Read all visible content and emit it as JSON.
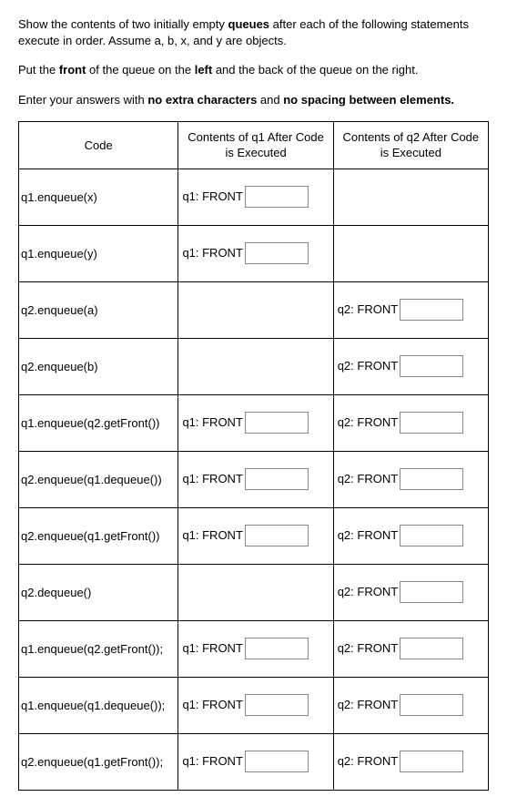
{
  "instructions": {
    "p1_a": "Show the contents of two initially empty ",
    "p1_b": "queues",
    "p1_c": " after each of the following statements execute in order. Assume a, b, x, and y are objects.",
    "p2_a": "Put the ",
    "p2_b": "front",
    "p2_c": " of the queue on the ",
    "p2_d": "left",
    "p2_e": " and the back of the queue on the right.",
    "p3_a": "Enter your answers with ",
    "p3_b": "no extra characters",
    "p3_c": " and ",
    "p3_d": "no spacing between elements."
  },
  "headers": {
    "code": "Code",
    "q1": "Contents of q1 After Code is Executed",
    "q2": "Contents of q2 After Code is Executed"
  },
  "labels": {
    "q1front": "q1: FRONT",
    "q2front": "q2: FRONT"
  },
  "rows": [
    {
      "code": "q1.enqueue(x)",
      "q1": true,
      "q2": false
    },
    {
      "code": "q1.enqueue(y)",
      "q1": true,
      "q2": false
    },
    {
      "code": "q2.enqueue(a)",
      "q1": false,
      "q2": true
    },
    {
      "code": "q2.enqueue(b)",
      "q1": false,
      "q2": true
    },
    {
      "code": "q1.enqueue(q2.getFront())",
      "q1": true,
      "q2": true
    },
    {
      "code": "q2.enqueue(q1.dequeue())",
      "q1": true,
      "q2": true
    },
    {
      "code": "q2.enqueue(q1.getFront())",
      "q1": true,
      "q2": true
    },
    {
      "code": "q2.dequeue()",
      "q1": false,
      "q2": true
    },
    {
      "code": "q1.enqueue(q2.getFront());",
      "q1": true,
      "q2": true
    },
    {
      "code": "q1.enqueue(q1.dequeue());",
      "q1": true,
      "q2": true
    },
    {
      "code": "q2.enqueue(q1.getFront());",
      "q1": true,
      "q2": true
    }
  ]
}
